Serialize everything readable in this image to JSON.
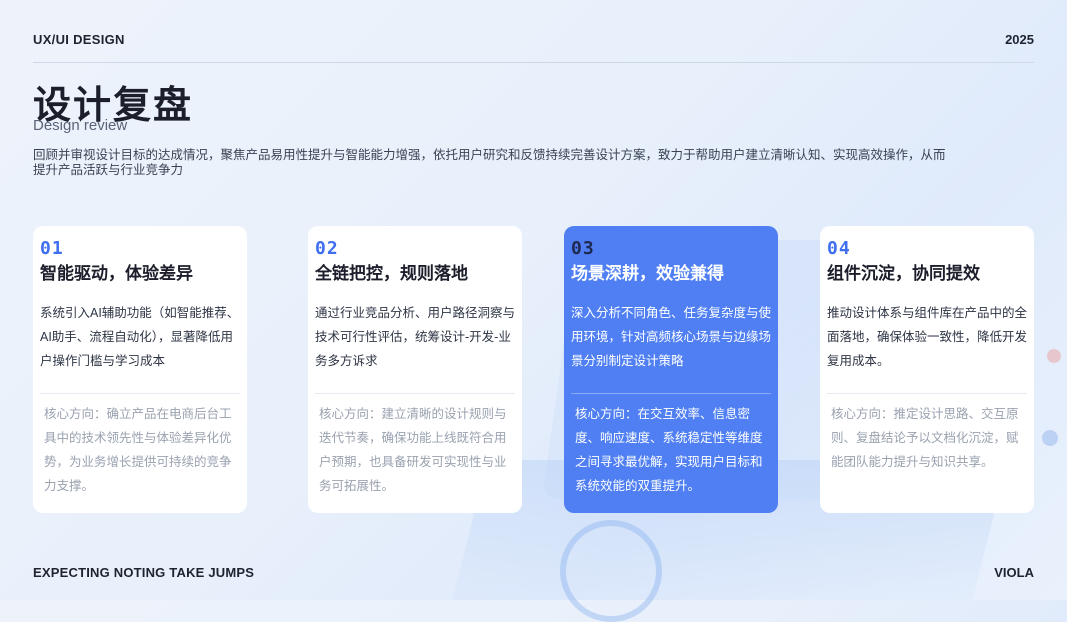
{
  "header": {
    "brand": "UX/UI DESIGN",
    "year": "2025"
  },
  "page": {
    "title": "设计复盘",
    "subtitle": "Design review",
    "description": "回顾并审视设计目标的达成情况，聚焦产品易用性提升与智能能力增强，依托用户研究和反馈持续完善设计方案，致力于帮助用户建立清晰认知、实现高效操作，从而提升产品活跃与行业竞争力"
  },
  "cards": [
    {
      "num": "01",
      "title": "智能驱动，体验差异",
      "body": "系统引入AI辅助功能（如智能推荐、AI助手、流程自动化），显著降低用户操作门槛与学习成本",
      "core": "核心方向：确立产品在电商后台工具中的技术领先性与体验差异化优势，为业务增长提供可持续的竞争力支撑。"
    },
    {
      "num": "02",
      "title": "全链把控，规则落地",
      "body": "通过行业竞品分析、用户路径洞察与技术可行性评估，统筹设计-开发-业务多方诉求",
      "core": "核心方向：建立清晰的设计规则与迭代节奏，确保功能上线既符合用户预期，也具备研发可实现性与业务可拓展性。"
    },
    {
      "num": "03",
      "title": "场景深耕，效验兼得",
      "body": "深入分析不同角色、任务复杂度与使用环境，针对高频核心场景与边缘场景分别制定设计策略",
      "core": "核心方向：在交互效率、信息密度、响应速度、系统稳定性等维度之间寻求最优解，实现用户目标和系统效能的双重提升。"
    },
    {
      "num": "04",
      "title": "组件沉淀，协同提效",
      "body": "推动设计体系与组件库在产品中的全面落地，确保体验一致性，降低开发复用成本。",
      "core": "核心方向：推定设计思路、交互原则、复盘结论予以文档化沉淀，赋能团队能力提升与知识共享。"
    }
  ],
  "footer": {
    "left": "EXPECTING NOTING  TAKE JUMPS",
    "right": "VIOLA"
  },
  "colors": {
    "accent": "#4f7ff2",
    "number": "#3f6ef0"
  }
}
